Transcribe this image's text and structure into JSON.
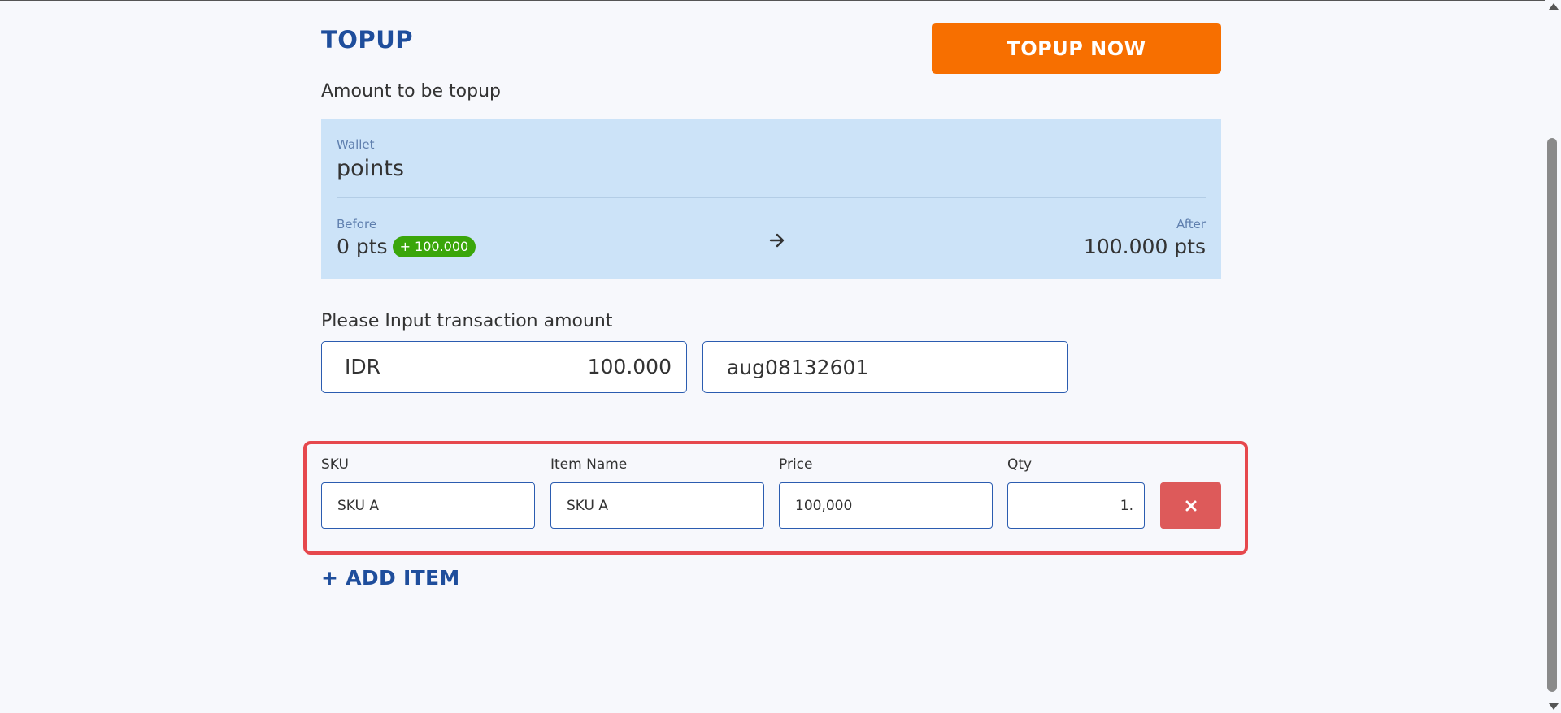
{
  "header": {
    "title": "TOPUP",
    "topup_button": "TOPUP NOW",
    "amount_label": "Amount to be topup"
  },
  "wallet": {
    "caption": "Wallet",
    "name": "points",
    "before_caption": "Before",
    "before_value": "0 pts",
    "delta_badge": "+ 100.000",
    "after_caption": "After",
    "after_value": "100.000 pts"
  },
  "transaction": {
    "label": "Please Input transaction amount",
    "currency": "IDR",
    "amount": "100.000",
    "reference": "aug08132601"
  },
  "items": {
    "columns": {
      "sku": "SKU",
      "name": "Item Name",
      "price": "Price",
      "qty": "Qty"
    },
    "rows": [
      {
        "sku": "SKU A",
        "name": "SKU A",
        "price": "100,000",
        "qty": "1."
      }
    ],
    "add_item": "+ ADD ITEM"
  },
  "colors": {
    "primary": "#1f4e9c",
    "accent": "#f76f00",
    "wallet_bg": "#cce3f8",
    "badge": "#3aa60a",
    "danger": "#dd5a5a",
    "highlight": "#e6484d"
  }
}
